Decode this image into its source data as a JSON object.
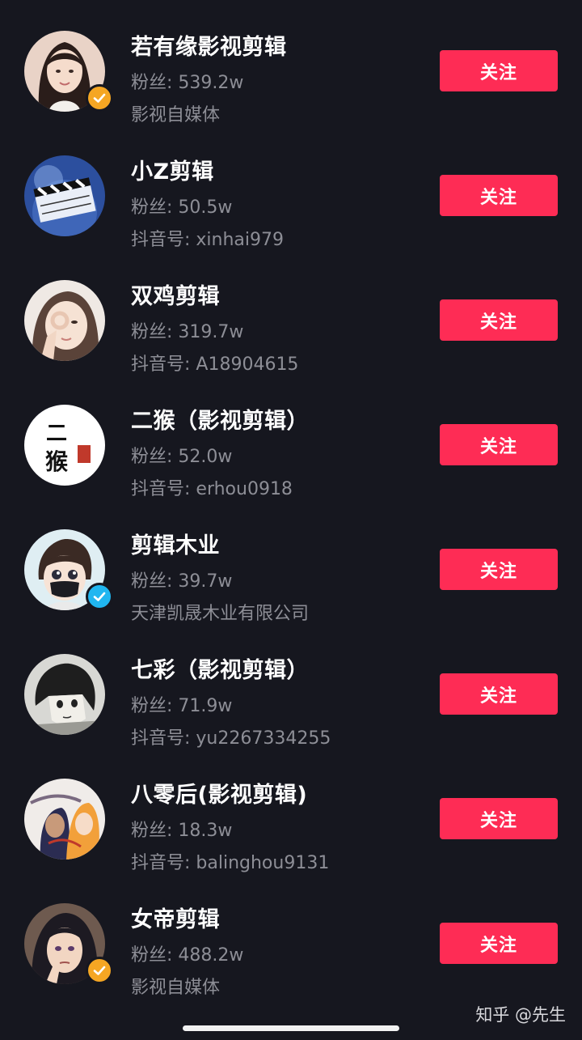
{
  "follow_label": "关注",
  "fans_prefix": "粉丝: ",
  "accent_color": "#fe2c55",
  "badge_colors": {
    "gold": "#f5a623",
    "blue": "#20b6f0"
  },
  "accounts": [
    {
      "name": "若有缘影视剪辑",
      "fans": "539.2w",
      "desc": "影视自媒体",
      "badge": "gold",
      "avatar": "girl-braids-avatar"
    },
    {
      "name": "小Z剪辑",
      "fans": "50.5w",
      "desc": "抖音号: xinhai979",
      "badge": "",
      "avatar": "clapperboard-avatar"
    },
    {
      "name": "双鸡剪辑",
      "fans": "319.7w",
      "desc": "抖音号: A18904615",
      "badge": "",
      "avatar": "ok-hand-girl-avatar"
    },
    {
      "name": "二猴（影视剪辑）",
      "fans": "52.0w",
      "desc": "抖音号: erhou0918",
      "badge": "",
      "avatar": "calligraphy-avatar",
      "avatar_text": "二\n猴"
    },
    {
      "name": "剪辑木业",
      "fans": "39.7w",
      "desc": "天津凯晟木业有限公司",
      "badge": "blue",
      "avatar": "cartoon-boy-mask-avatar"
    },
    {
      "name": "七彩（影视剪辑）",
      "fans": "71.9w",
      "desc": "抖音号: yu2267334255",
      "badge": "",
      "avatar": "anime-sketch-avatar"
    },
    {
      "name": "八零后(影视剪辑)",
      "fans": "18.3w",
      "desc": "抖音号: balinghou9131",
      "badge": "",
      "avatar": "anime-duo-avatar"
    },
    {
      "name": "女帝剪辑",
      "fans": "488.2w",
      "desc": "影视自媒体",
      "badge": "gold",
      "avatar": "anime-woman-avatar"
    }
  ],
  "watermark": "知乎 @先生"
}
